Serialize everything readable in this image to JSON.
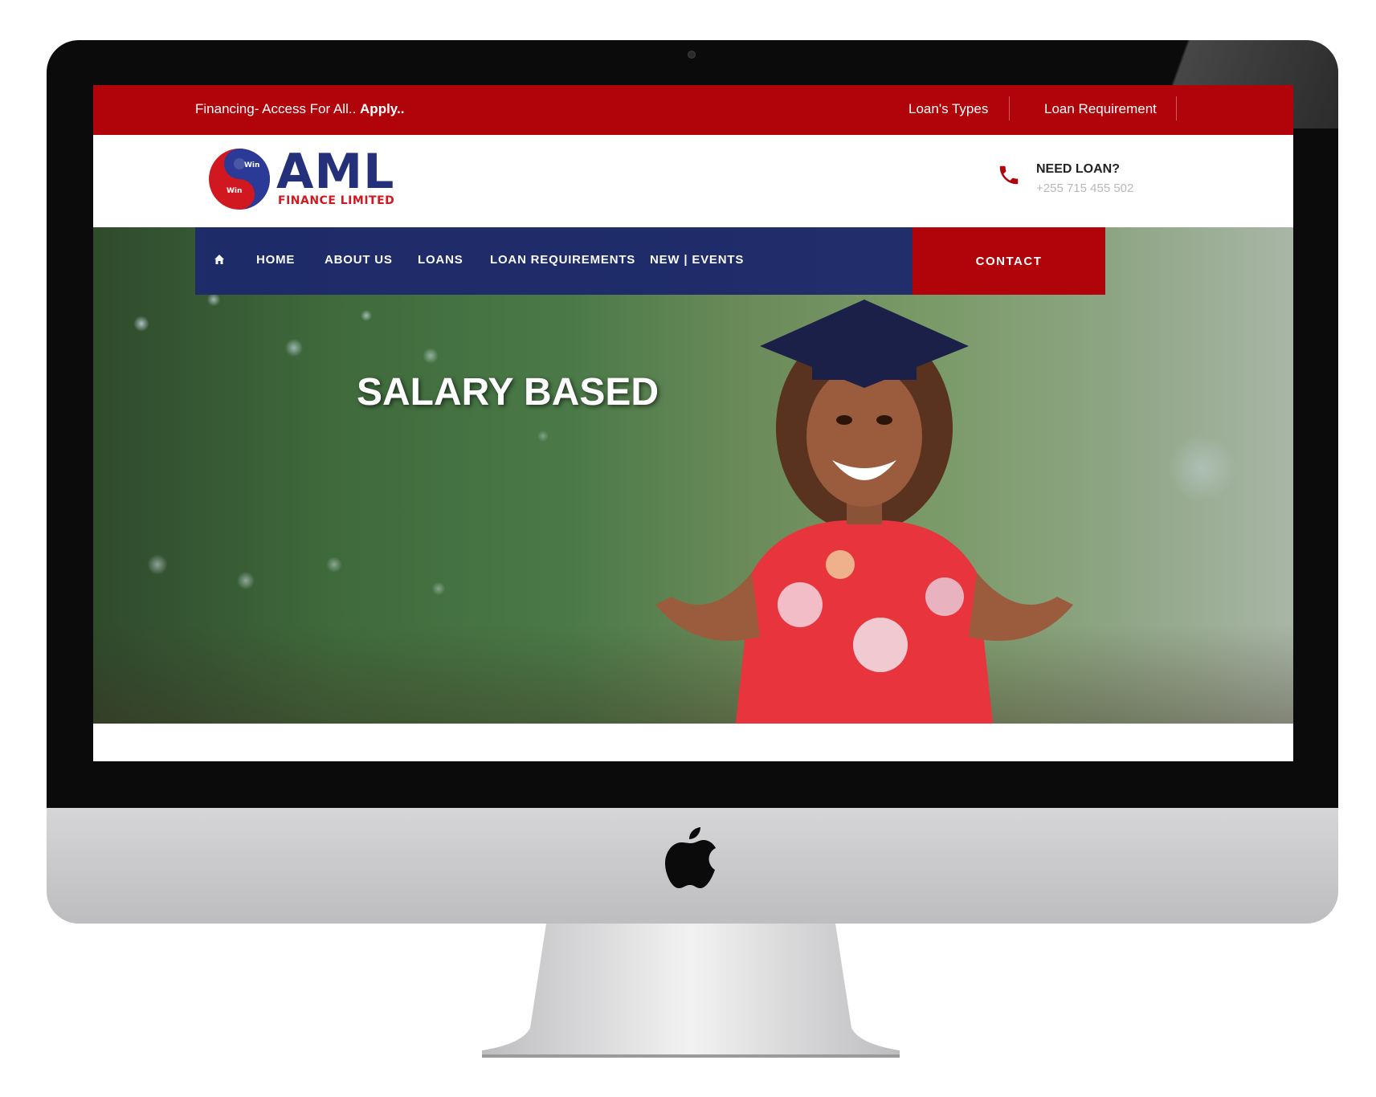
{
  "topbar": {
    "tagline": "Financing- Access For All.. ",
    "apply": "Apply..",
    "links": [
      "Loan's Types",
      "Loan Requirement"
    ]
  },
  "header": {
    "logo_text": "AML",
    "logo_sub": "FINANCE LIMITED",
    "logo_badge_top": "Win",
    "logo_badge_bottom": "Win",
    "need_loan": "NEED LOAN?",
    "phone": "+255 715 455 502"
  },
  "nav": {
    "home_icon": "home-icon",
    "items": [
      "HOME",
      "ABOUT US",
      "LOANS",
      "LOAN REQUIREMENTS",
      "NEW | EVENTS"
    ],
    "contact": "CONTACT"
  },
  "hero": {
    "title": "SALARY BASED"
  },
  "colors": {
    "brand_red": "#b0040a",
    "brand_navy": "#1e2a6b",
    "logo_blue": "#24307a",
    "logo_red": "#d11820"
  }
}
